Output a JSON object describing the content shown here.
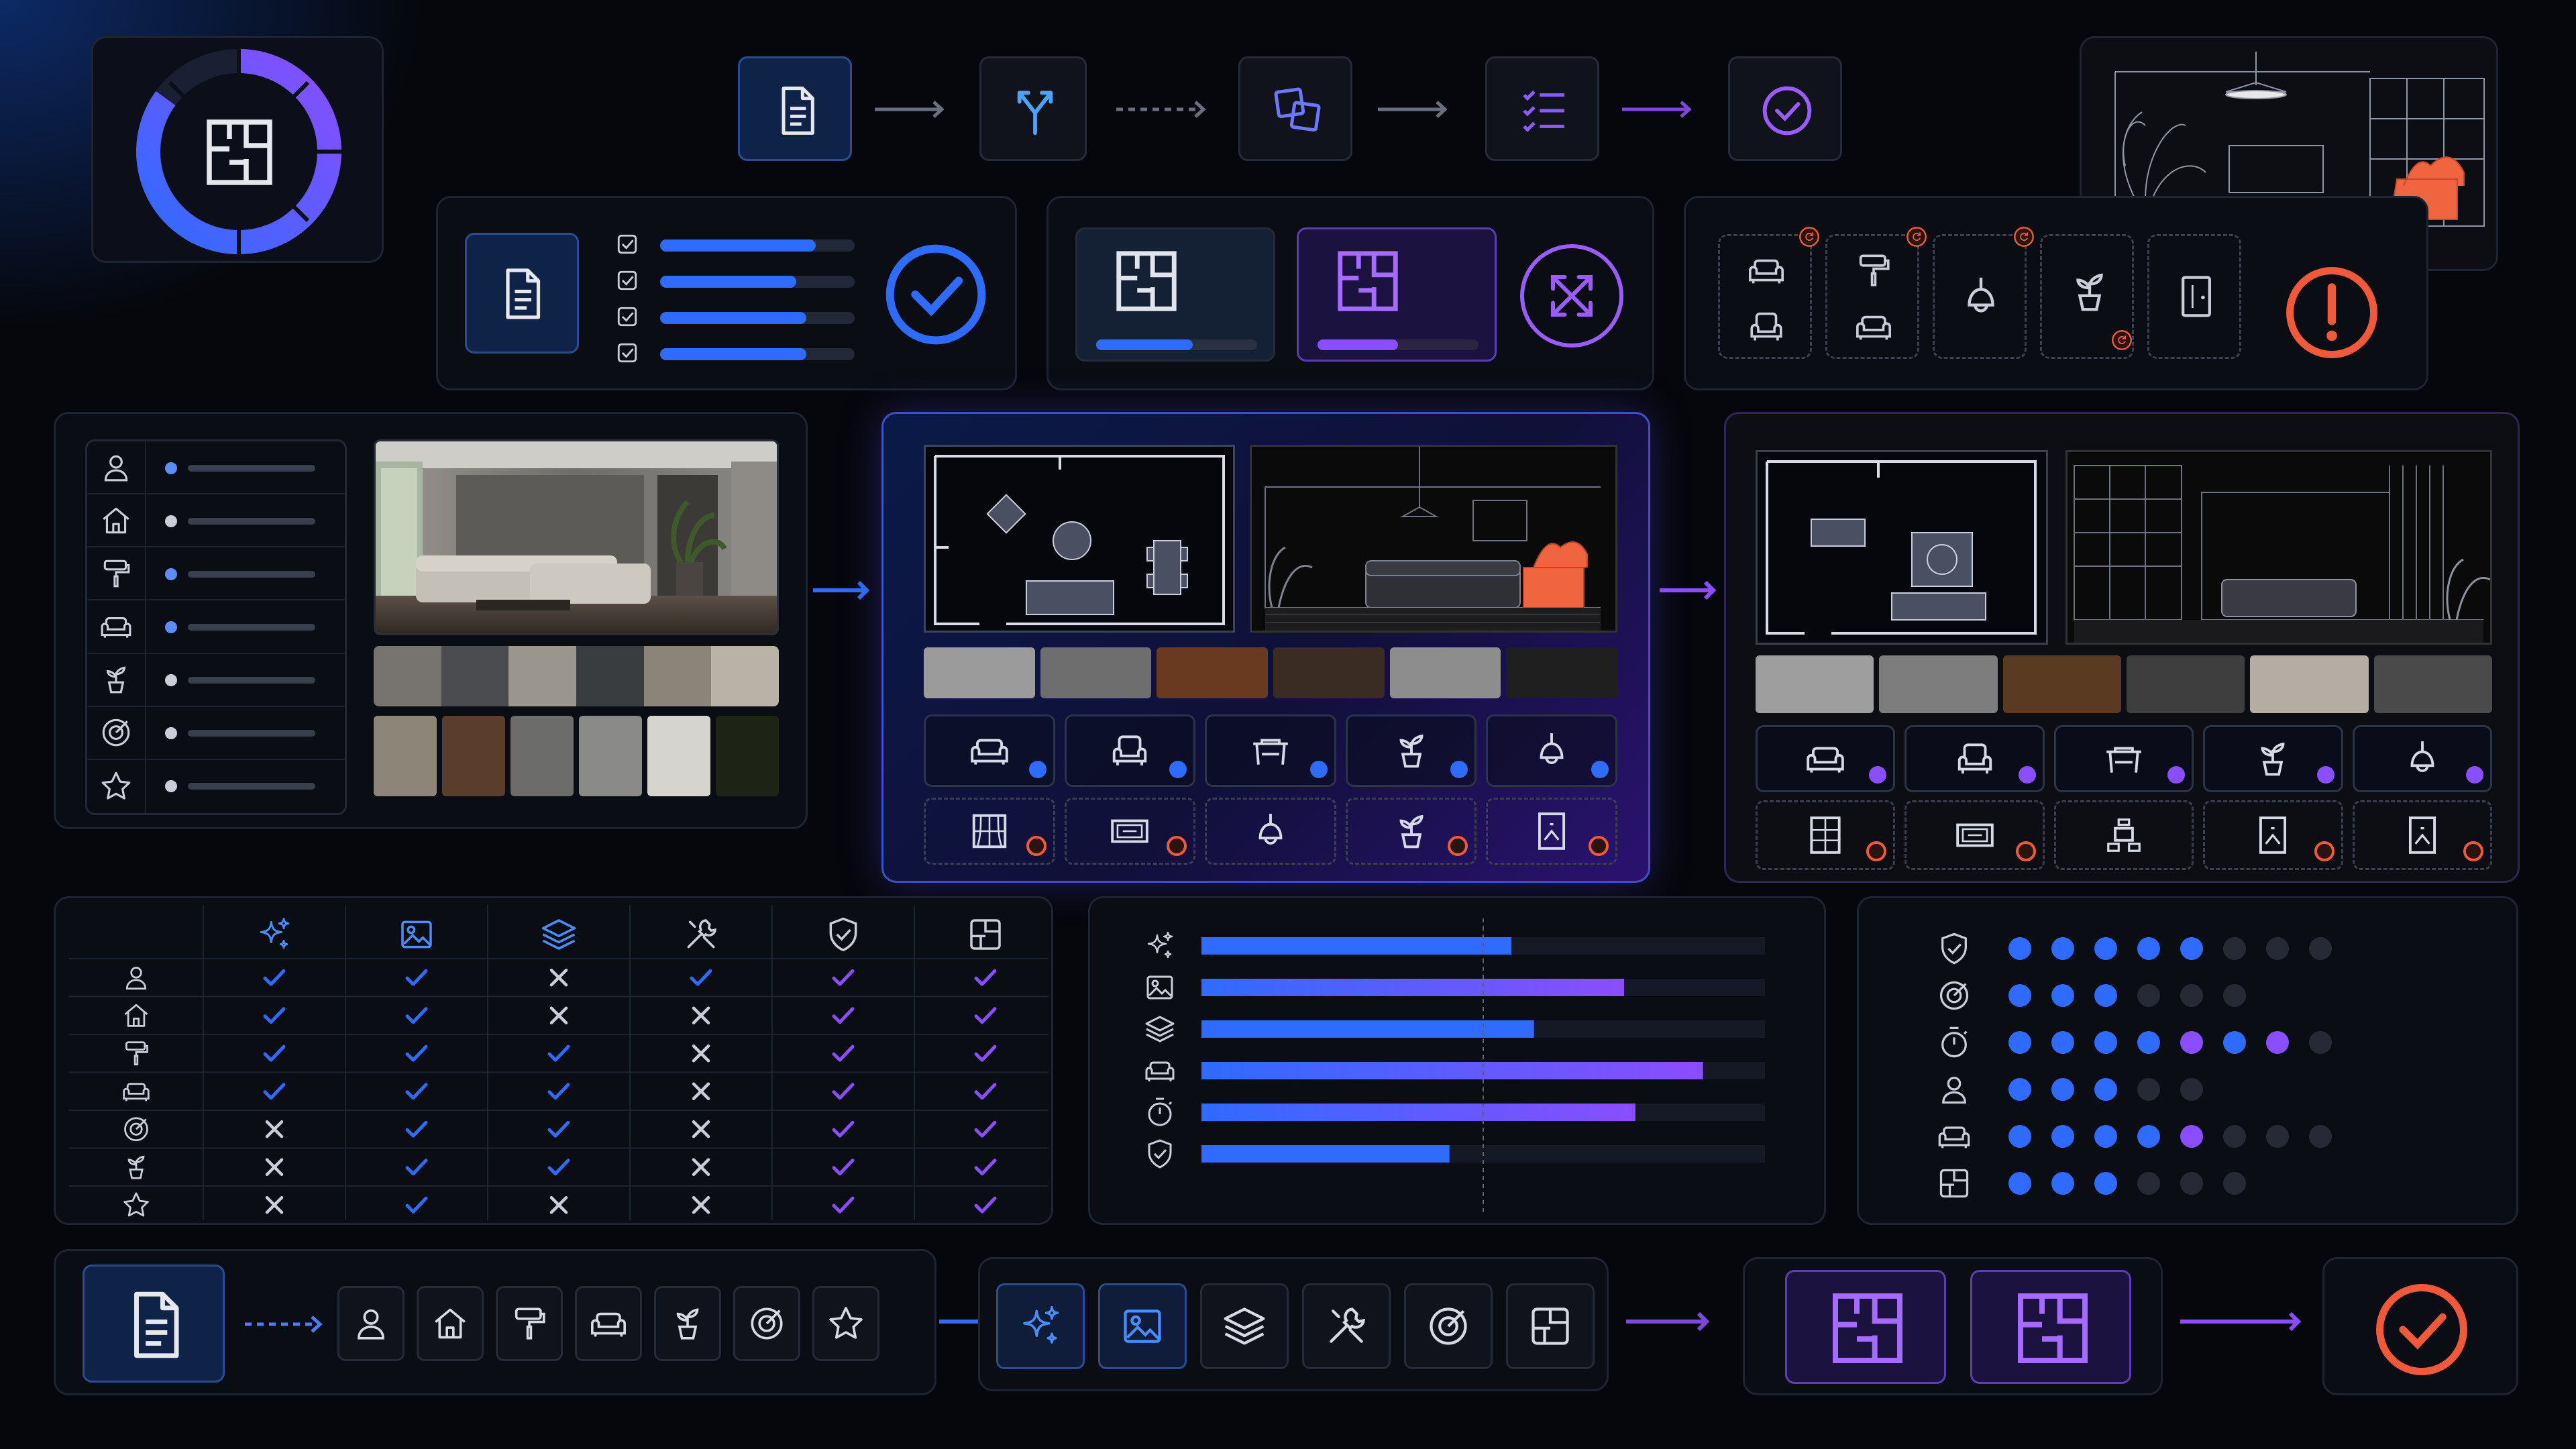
{
  "colors": {
    "blue": "#2f6bff",
    "purple": "#8a4dff",
    "orange": "#f05a3a",
    "panel": "#0b0d14",
    "border": "#1f2433",
    "muted": "#9aa3b8"
  },
  "top_workflow": {
    "steps": [
      "document-icon",
      "split-icon",
      "compare-icon",
      "checklist-icon",
      "check-circle-icon"
    ]
  },
  "progress_ring": {
    "icon": "floor-plan-icon",
    "fill": 0.85
  },
  "review_card": {
    "icon": "document-icon",
    "items_progress": [
      0.8,
      0.7,
      0.75,
      0.75
    ]
  },
  "compare_card": {
    "plans": [
      {
        "progress": 0.6,
        "color": "blue"
      },
      {
        "progress": 0.5,
        "color": "purple"
      }
    ],
    "action_icon": "shuffle-icon"
  },
  "issues_card": {
    "icons": [
      "sofa-icon",
      "paint-roller-icon",
      "lamp-icon",
      "plant-icon",
      "door-icon"
    ],
    "alert_icon": "alert-icon"
  },
  "input_panel": {
    "categories": [
      "user-icon",
      "home-icon",
      "paint-roller-icon",
      "sofa-icon",
      "plant-icon",
      "target-icon",
      "star-icon"
    ],
    "swatch_colors": [
      "#77746f",
      "#4a4c4f",
      "#9b968d",
      "#3a3d40",
      "#8b8478",
      "#b9b2a6"
    ],
    "texture_colors": [
      "#8d8577",
      "#5a3e2b",
      "#6c6c6b",
      "#8a8a88",
      "#d6d4cf",
      "#1d2416"
    ]
  },
  "concept_a": {
    "swatch_colors": [
      "#9b9b9b",
      "#6e6e6e",
      "#6a3a20",
      "#3a2c22",
      "#8d8d8d",
      "#1f1f1f"
    ],
    "items_row1": [
      "sofa-icon",
      "armchair-icon",
      "table-icon",
      "plant-icon",
      "pendant-lamp-icon"
    ],
    "items_row2": [
      "window-icon",
      "rug-icon",
      "lamp-icon",
      "plant-icon",
      "art-icon"
    ]
  },
  "concept_b": {
    "swatch_colors": [
      "#9e9e9e",
      "#7d7d7d",
      "#5b3a22",
      "#3e3e3e",
      "#b3ada3",
      "#4a4a4a"
    ],
    "items_row1": [
      "sofa-icon",
      "armchair-icon",
      "table-icon",
      "plant-icon",
      "pendant-lamp-icon"
    ],
    "items_row2": [
      "shelf-icon",
      "rug-icon",
      "dining-icon",
      "art-icon",
      "art-icon"
    ]
  },
  "matrix": {
    "columns": [
      "sparkle-icon",
      "image-icon",
      "layers-icon",
      "tools-icon",
      "shield-icon",
      "layout-icon"
    ],
    "rows": [
      {
        "icon": "user-icon",
        "cells": [
          "check",
          "check",
          "cross",
          "check",
          "check",
          "check"
        ]
      },
      {
        "icon": "home-icon",
        "cells": [
          "check",
          "check",
          "cross",
          "cross",
          "check",
          "check"
        ]
      },
      {
        "icon": "paint-roller-icon",
        "cells": [
          "check",
          "check",
          "check",
          "cross",
          "check",
          "check"
        ]
      },
      {
        "icon": "sofa-icon",
        "cells": [
          "check",
          "check",
          "check",
          "cross",
          "check",
          "check"
        ]
      },
      {
        "icon": "target-icon",
        "cells": [
          "cross",
          "check",
          "check",
          "cross",
          "check",
          "check"
        ]
      },
      {
        "icon": "plant-icon",
        "cells": [
          "cross",
          "check",
          "check",
          "cross",
          "check",
          "check"
        ]
      },
      {
        "icon": "star-icon",
        "cells": [
          "cross",
          "check",
          "cross",
          "cross",
          "check",
          "check"
        ]
      }
    ]
  },
  "chart_data": {
    "type": "bar",
    "orientation": "horizontal",
    "categories": [
      "sparkle-icon",
      "image-icon",
      "layers-icon",
      "sofa-icon",
      "timer-icon",
      "shield-icon"
    ],
    "values": [
      0.55,
      0.75,
      0.59,
      0.89,
      0.77,
      0.44
    ],
    "xlim": [
      0,
      1
    ],
    "threshold": 0.5,
    "grid": false
  },
  "rating": {
    "rows": [
      {
        "icon": "shield-icon",
        "dots": [
          "b",
          "b",
          "b",
          "b",
          "b",
          "o",
          "o",
          "o"
        ]
      },
      {
        "icon": "target-icon",
        "dots": [
          "b",
          "b",
          "b",
          "o",
          "o",
          "o"
        ]
      },
      {
        "icon": "timer-icon",
        "dots": [
          "b",
          "b",
          "b",
          "b",
          "p",
          "b",
          "p",
          "o"
        ]
      },
      {
        "icon": "user-icon",
        "dots": [
          "b",
          "b",
          "b",
          "o",
          "o"
        ]
      },
      {
        "icon": "sofa-icon",
        "dots": [
          "b",
          "b",
          "b",
          "b",
          "p",
          "o",
          "o",
          "o"
        ]
      },
      {
        "icon": "layout-icon",
        "dots": [
          "b",
          "b",
          "b",
          "o",
          "o",
          "o"
        ]
      }
    ]
  },
  "bottom_flow": {
    "start_icon": "document-icon",
    "inputs": [
      "user-icon",
      "home-icon",
      "paint-roller-icon",
      "sofa-icon",
      "plant-icon",
      "target-icon",
      "star-icon"
    ],
    "tools": [
      "sparkle-icon",
      "image-icon",
      "layers-icon",
      "tools-icon",
      "target-icon",
      "layout-icon"
    ],
    "outputs": [
      "floor-plan-icon",
      "floor-plan-icon"
    ],
    "end_icon": "check-circle-icon"
  }
}
